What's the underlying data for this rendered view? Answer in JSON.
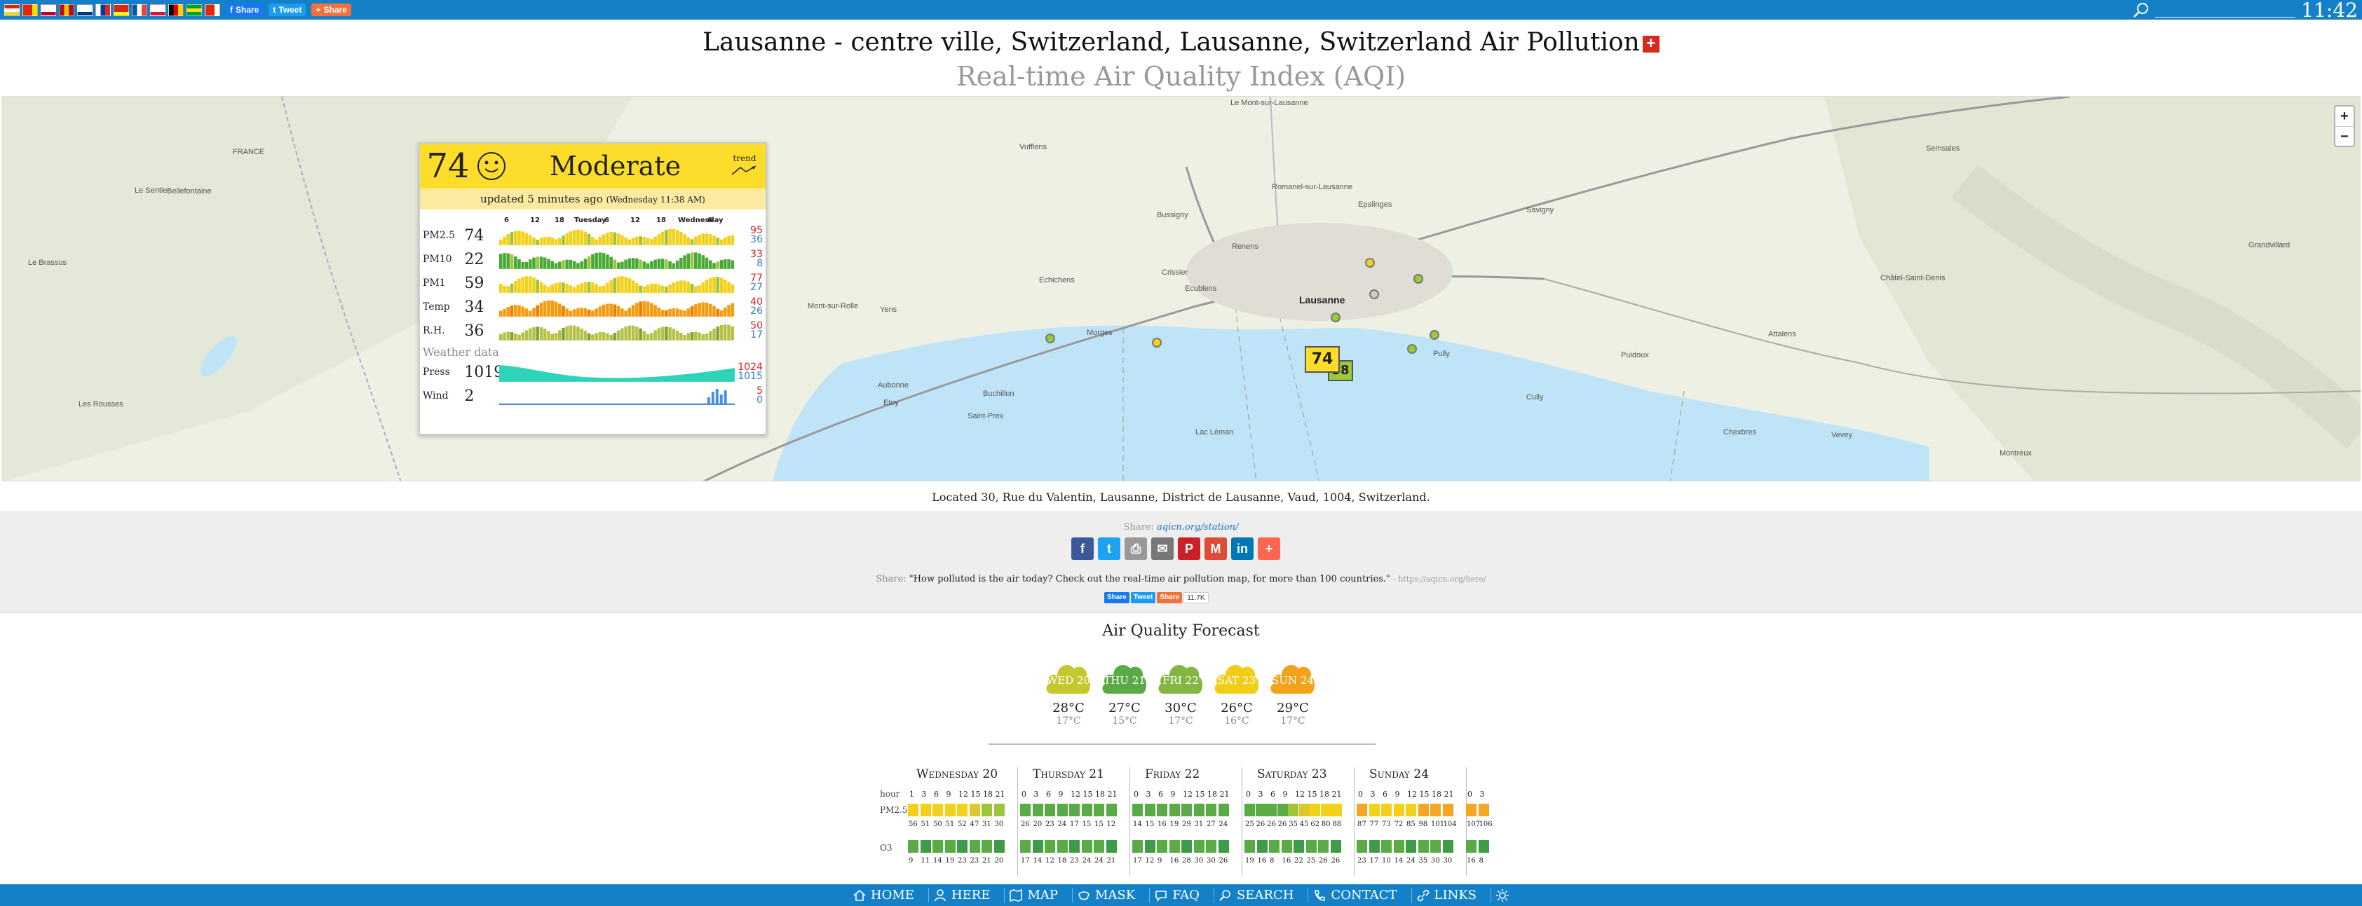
{
  "topbar": {
    "flags": [
      {
        "name": "kosovo-flag",
        "colors": [
          "#d22",
          "#fff",
          "#dd3"
        ]
      },
      {
        "name": "china-flag",
        "colors": [
          "#de2910",
          "#de2910",
          "#ffde00"
        ]
      },
      {
        "name": "japan-flag",
        "colors": [
          "#fff",
          "#fff",
          "#bc002d"
        ]
      },
      {
        "name": "spain-flag",
        "colors": [
          "#aa151b",
          "#f1bf00",
          "#aa151b"
        ]
      },
      {
        "name": "korea-flag",
        "colors": [
          "#fff",
          "#fff",
          "#003478"
        ]
      },
      {
        "name": "russia-flag",
        "colors": [
          "#fff",
          "#0039a6",
          "#d52b1e"
        ]
      },
      {
        "name": "vietnam-flag",
        "colors": [
          "#da251d",
          "#da251d",
          "#ff0"
        ]
      },
      {
        "name": "france-flag",
        "colors": [
          "#0055a4",
          "#fff",
          "#ef4135"
        ]
      },
      {
        "name": "poland-flag",
        "colors": [
          "#fff",
          "#fff",
          "#dc143c"
        ]
      },
      {
        "name": "germany-flag",
        "colors": [
          "#000",
          "#dd0000",
          "#ffce00"
        ]
      },
      {
        "name": "brazil-flag",
        "colors": [
          "#009c3b",
          "#ffdf00",
          "#009c3b"
        ]
      },
      {
        "name": "hongkong-flag",
        "colors": [
          "#de2910",
          "#de2910",
          "#fff"
        ]
      }
    ],
    "share_fb": "Share",
    "share_tw": "Tweet",
    "share_sh": "Share",
    "search_placeholder": "",
    "clock": "11:42"
  },
  "header": {
    "title": "Lausanne - centre ville, Switzerland, Lausanne, Switzerland Air Pollution",
    "subtitle": "Real-time Air Quality Index (AQI)"
  },
  "map": {
    "labels": [
      {
        "name": "lausanne",
        "text": "Lausanne",
        "city": true
      },
      {
        "name": "echichens",
        "text": "Echichens"
      },
      {
        "name": "aubonne",
        "text": "Aubonne"
      },
      {
        "name": "buchillon",
        "text": "Buchillon"
      },
      {
        "name": "saint-prex",
        "text": "Saint-Prex"
      },
      {
        "name": "lac-leman",
        "text": "Lac Léman"
      },
      {
        "name": "cully",
        "text": "Cully"
      },
      {
        "name": "vufflens",
        "text": "Vufflens"
      },
      {
        "name": "savigny",
        "text": "Savigny"
      },
      {
        "name": "crissier",
        "text": "Crissier"
      },
      {
        "name": "renens",
        "text": "Renens"
      },
      {
        "name": "ecublens",
        "text": "Ecublens"
      },
      {
        "name": "bussigny",
        "text": "Bussigny"
      },
      {
        "name": "morges",
        "text": "Morges"
      },
      {
        "name": "puidoux",
        "text": "Puidoux"
      },
      {
        "name": "chexbres",
        "text": "Chexbres"
      },
      {
        "name": "romanel",
        "text": "Romanel-sur-Lausanne"
      },
      {
        "name": "etoy",
        "text": "Etoy"
      },
      {
        "name": "belle-fontaine",
        "text": "Bellefontaine"
      },
      {
        "name": "le-brassus",
        "text": "Le Brassus"
      },
      {
        "name": "yens",
        "text": "Yens"
      },
      {
        "name": "pully",
        "text": "Pully"
      },
      {
        "name": "le-mont",
        "text": "Le Mont-sur-Lausanne"
      },
      {
        "name": "epalinges",
        "text": "Epalinges"
      },
      {
        "name": "chatel",
        "text": "Châtel-Saint-Denis"
      },
      {
        "name": "semsales",
        "text": "Semsales"
      },
      {
        "name": "grandvillard",
        "text": "Grandvillard"
      },
      {
        "name": "vevey",
        "text": "Vevey"
      },
      {
        "name": "montreux",
        "text": "Montreux"
      },
      {
        "name": "le-sentier",
        "text": "Le Sentier"
      },
      {
        "name": "france",
        "text": "FRANCE"
      },
      {
        "name": "attalens",
        "text": "Attalens"
      },
      {
        "name": "les-rousses",
        "text": "Les Rousses"
      },
      {
        "name": "mont-sur-rolle",
        "text": "Mont-sur-Rolle"
      }
    ],
    "marker_main": "74",
    "marker_second": "58",
    "zoom_in": "+",
    "zoom_out": "−"
  },
  "card": {
    "aqi": "74",
    "level": "Moderate",
    "trend": "trend",
    "updated": "updated 5 minutes ago",
    "updated_time": "(Wednesday 11:38 AM)",
    "hours": [
      "6",
      "12",
      "18",
      "Tuesday",
      "6",
      "12",
      "18",
      "Wednesday",
      "6"
    ],
    "rows": [
      {
        "name": "pm25",
        "label": "PM2.5",
        "sub": "",
        "value": "74",
        "max": "95",
        "min": "36",
        "color": "#f3d019",
        "color2": "#9dc43b"
      },
      {
        "name": "pm10",
        "label": "PM10",
        "sub": "",
        "value": "22",
        "max": "33",
        "min": "8",
        "color": "#49a935",
        "color2": "#9dc43b"
      },
      {
        "name": "pm1",
        "label": "PM1",
        "sub": "",
        "value": "59",
        "max": "77",
        "min": "27",
        "color": "#f3d019",
        "color2": "#9dc43b"
      },
      {
        "name": "temp",
        "label": "Temp",
        "sub": "",
        "value": "34",
        "max": "40",
        "min": "26",
        "color": "#f59b0e",
        "color2": "#f07d00"
      },
      {
        "name": "rh",
        "label": "R.H.",
        "sub": "",
        "value": "36",
        "max": "50",
        "min": "17",
        "color": "#b7c14a",
        "color2": "#7fa535"
      }
    ],
    "weather_label": "Weather data",
    "press": {
      "label": "Press",
      "value": "1019",
      "max": "1024",
      "min": "1015"
    },
    "wind": {
      "label": "Wind",
      "value": "2",
      "max": "5",
      "min": "0"
    }
  },
  "location": "Located 30, Rue du Valentin, Lausanne, District de Lausanne, Vaud, 1004, Switzerland.",
  "share": {
    "label": "Share:",
    "link": "aqicn.org/station/",
    "icons": [
      {
        "name": "facebook-icon",
        "glyph": "f",
        "color": "#3b5998"
      },
      {
        "name": "twitter-icon",
        "glyph": "t",
        "color": "#1da1f2"
      },
      {
        "name": "print-icon",
        "glyph": "⎙",
        "color": "#999"
      },
      {
        "name": "email-icon",
        "glyph": "✉",
        "color": "#777"
      },
      {
        "name": "pinterest-icon",
        "glyph": "P",
        "color": "#cb2027"
      },
      {
        "name": "gmail-icon",
        "glyph": "M",
        "color": "#dd4b39"
      },
      {
        "name": "linkedin-icon",
        "glyph": "in",
        "color": "#0077b5"
      },
      {
        "name": "more-icon",
        "glyph": "+",
        "color": "#ff6550"
      }
    ],
    "quote_label": "Share:",
    "quote": "\"How polluted is the air today? Check out the real-time air pollution map, for more than 100 countries.\"",
    "quote_url": "- https://aqicn.org/here/",
    "mini_fb": "Share",
    "mini_tw": "Tweet",
    "mini_sh": "Share",
    "mini_count": "11.7K"
  },
  "forecast": {
    "heading": "Air Quality Forecast",
    "days": [
      {
        "name": "wed",
        "label": "WED 20",
        "color": "#c4c82e",
        "high": "28°C",
        "low": "17°C"
      },
      {
        "name": "thu",
        "label": "THU 21",
        "color": "#5aaa45",
        "high": "27°C",
        "low": "15°C"
      },
      {
        "name": "fri",
        "label": "FRI 22",
        "color": "#84b641",
        "high": "30°C",
        "low": "17°C"
      },
      {
        "name": "sat",
        "label": "SAT 23",
        "color": "#f2cd18",
        "high": "26°C",
        "low": "16°C"
      },
      {
        "name": "sun",
        "label": "SUN 24",
        "color": "#f3a21b",
        "high": "29°C",
        "low": "17°C"
      }
    ]
  },
  "hourly": {
    "hour_label": "hour",
    "pm_label": "PM2.5",
    "o3_label": "O3",
    "days": [
      "Wednesday 20",
      "Thursday 21",
      "Friday 22",
      "Saturday 23",
      "Sunday 24"
    ],
    "hours": [
      [
        "1",
        "3",
        "6",
        "9",
        "12",
        "15",
        "18",
        "21"
      ],
      [
        "0",
        "3",
        "6",
        "9",
        "12",
        "15",
        "18",
        "21"
      ],
      [
        "0",
        "3",
        "6",
        "9",
        "12",
        "15",
        "18",
        "21"
      ],
      [
        "0",
        "3",
        "6",
        "9",
        "12",
        "15",
        "18",
        "21"
      ],
      [
        "0",
        "3",
        "6",
        "9",
        "12",
        "15",
        "18",
        "21"
      ],
      [
        "0",
        "3"
      ]
    ],
    "pm_values": [
      [
        "56",
        "51",
        "50",
        "51",
        "52",
        "47",
        "31",
        "30"
      ],
      [
        "26",
        "20",
        "23",
        "24",
        "17",
        "15",
        "15",
        "12"
      ],
      [
        "14",
        "15",
        "16",
        "19",
        "29",
        "31",
        "27",
        "24"
      ],
      [
        "25",
        "26",
        "26",
        "26",
        "35",
        "45",
        "62",
        "80",
        "88"
      ],
      [
        "87",
        "77",
        "73",
        "72",
        "85",
        "98",
        "101",
        "104"
      ],
      [
        "107",
        "106"
      ]
    ],
    "pm_colors": [
      [
        "#f3d019",
        "#f3d019",
        "#f3d019",
        "#f3d019",
        "#f3d019",
        "#dcc82a",
        "#9dc43b",
        "#9dc43b"
      ],
      [
        "#5aaa45",
        "#5aaa45",
        "#5aaa45",
        "#5aaa45",
        "#5aaa45",
        "#5aaa45",
        "#5aaa45",
        "#5aaa45"
      ],
      [
        "#5aaa45",
        "#5aaa45",
        "#5aaa45",
        "#5aaa45",
        "#5aaa45",
        "#5aaa45",
        "#5aaa45",
        "#5aaa45"
      ],
      [
        "#5aaa45",
        "#5aaa45",
        "#5aaa45",
        "#5aaa45",
        "#9dc43b",
        "#dcc82a",
        "#f3d019",
        "#f3d019",
        "#f3d019"
      ],
      [
        "#f5a623",
        "#f3d019",
        "#f3d019",
        "#f3d019",
        "#f3d019",
        "#f5a623",
        "#f5a623",
        "#f5a623"
      ],
      [
        "#f5a623",
        "#f5a623"
      ]
    ],
    "o3_values": [
      [
        "9",
        "11",
        "14",
        "19",
        "23",
        "23",
        "21",
        "20"
      ],
      [
        "17",
        "14",
        "12",
        "18",
        "23",
        "24",
        "24",
        "21"
      ],
      [
        "17",
        "12",
        "9",
        "16",
        "28",
        "30",
        "30",
        "26"
      ],
      [
        "19",
        "16",
        "8",
        "16",
        "22",
        "25",
        "26",
        "26"
      ],
      [
        "23",
        "17",
        "10",
        "14",
        "24",
        "35",
        "30",
        "30"
      ],
      [
        "16",
        "8"
      ]
    ]
  },
  "nav": [
    {
      "name": "home",
      "label": "HOME"
    },
    {
      "name": "here",
      "label": "HERE"
    },
    {
      "name": "map",
      "label": "MAP"
    },
    {
      "name": "mask",
      "label": "MASK"
    },
    {
      "name": "faq",
      "label": "FAQ"
    },
    {
      "name": "search",
      "label": "SEARCH"
    },
    {
      "name": "contact",
      "label": "CONTACT"
    },
    {
      "name": "links",
      "label": "LINKS"
    }
  ]
}
